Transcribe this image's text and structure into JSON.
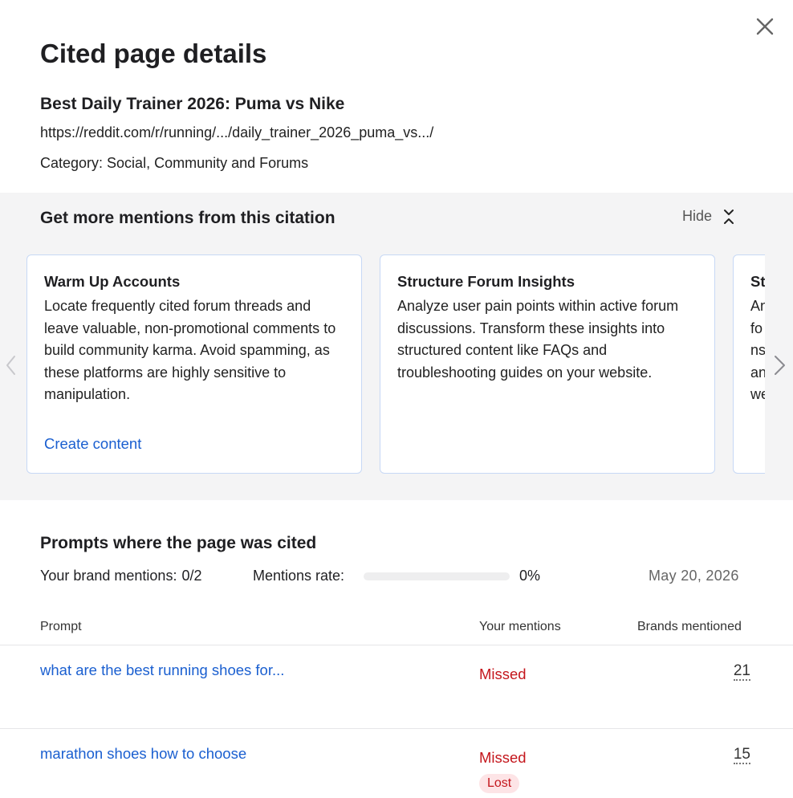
{
  "dialog": {
    "title": "Cited page details",
    "close_icon": "close-icon"
  },
  "cited_page": {
    "title": "Best Daily Trainer 2026: Puma vs Nike",
    "url": "https://reddit.com/r/running/.../daily_trainer_2026_puma_vs.../",
    "category": "Category: Social, Community and Forums"
  },
  "mentions_section": {
    "heading": "Get more mentions from this citation",
    "hide_label": "Hide",
    "hide_icon": "collapse-icon",
    "cards": [
      {
        "title": "Warm Up Accounts",
        "text": "Locate frequently cited forum threads and leave valuable, non-promotional comments to build community karma. Avoid spamming, as these platforms are highly sensitive to manipulation.",
        "link": "Create content"
      },
      {
        "title": "Structure Forum Insights",
        "text": "Analyze user pain points within active forum discussions. Transform these insights into structured content like FAQs and troubleshooting guides on your website."
      },
      {
        "title": "St",
        "text": "An fo ins an we"
      }
    ]
  },
  "prompts_section": {
    "heading": "Prompts where the page was cited",
    "brand_mentions_label": "Your brand mentions:",
    "brand_mentions_value": "0/2",
    "rate_label": "Mentions rate:",
    "rate_value": "0%",
    "rate_fraction": 0,
    "date": "May 20, 2026",
    "columns": {
      "prompt": "Prompt",
      "your_mentions": "Your mentions",
      "brands_mentioned": "Brands mentioned"
    },
    "rows": [
      {
        "prompt": "what are the best running shoes for...",
        "status": "Missed",
        "brands": "21"
      },
      {
        "prompt": "marathon shoes how to choose",
        "status": "Missed",
        "badge": "Lost",
        "brands": "15"
      }
    ]
  },
  "colors": {
    "link": "#1a5fd0",
    "missed": "#c4161c",
    "lost_badge_bg": "#fde4e6",
    "section_bg": "#f4f4f5",
    "card_border": "#c7d8f5"
  }
}
